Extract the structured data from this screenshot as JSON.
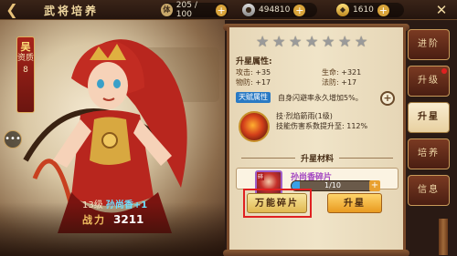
{
  "header": {
    "back_icon": "back-arrow-icon",
    "title": "武将培养",
    "stamina": "205 / 100",
    "silver": "494810",
    "gold": "1610",
    "close_icon": "close-icon"
  },
  "hero": {
    "badge_top": "吴",
    "badge_label": "资质",
    "badge_value": "8",
    "level": "13级",
    "name": "孙尚香+1",
    "power_label": "战力",
    "power_value": "3211"
  },
  "stars": {
    "total": 7,
    "filled": 0
  },
  "upgrade_panel": {
    "attr_title": "升星属性:",
    "stats": [
      {
        "key": "攻击:",
        "value": "+35"
      },
      {
        "key": "生命:",
        "value": "+321"
      },
      {
        "key": "物防:",
        "value": "+17"
      },
      {
        "key": "法防:",
        "value": "+17"
      }
    ],
    "talent_tag": "天赋属性",
    "talent_text": "自身闪避率永久增加5%。",
    "skill_name": "技·烈焰箭雨(1级)",
    "skill_desc": "技能伤害系数提升至: 112%",
    "materials_title": "升星材料",
    "fragment_tag": "碎",
    "fragment_name": "孙尚香碎片",
    "fragment_progress": "1/10",
    "fragment_progress_ratio": 0.1,
    "universal_button": "万能碎片",
    "upgrade_button": "升星"
  },
  "tabs": [
    {
      "label": "进阶",
      "active": false
    },
    {
      "label": "升级",
      "active": false
    },
    {
      "label": "升星",
      "active": true
    },
    {
      "label": "培养",
      "active": false
    },
    {
      "label": "信息",
      "active": false
    }
  ],
  "colors": {
    "accent_gold": "#e8a030",
    "progress_blue": "#3aa0e8",
    "fragment_purple": "#a040c0",
    "talent_blue": "#2a7ac4",
    "highlight_red": "#e02020"
  }
}
